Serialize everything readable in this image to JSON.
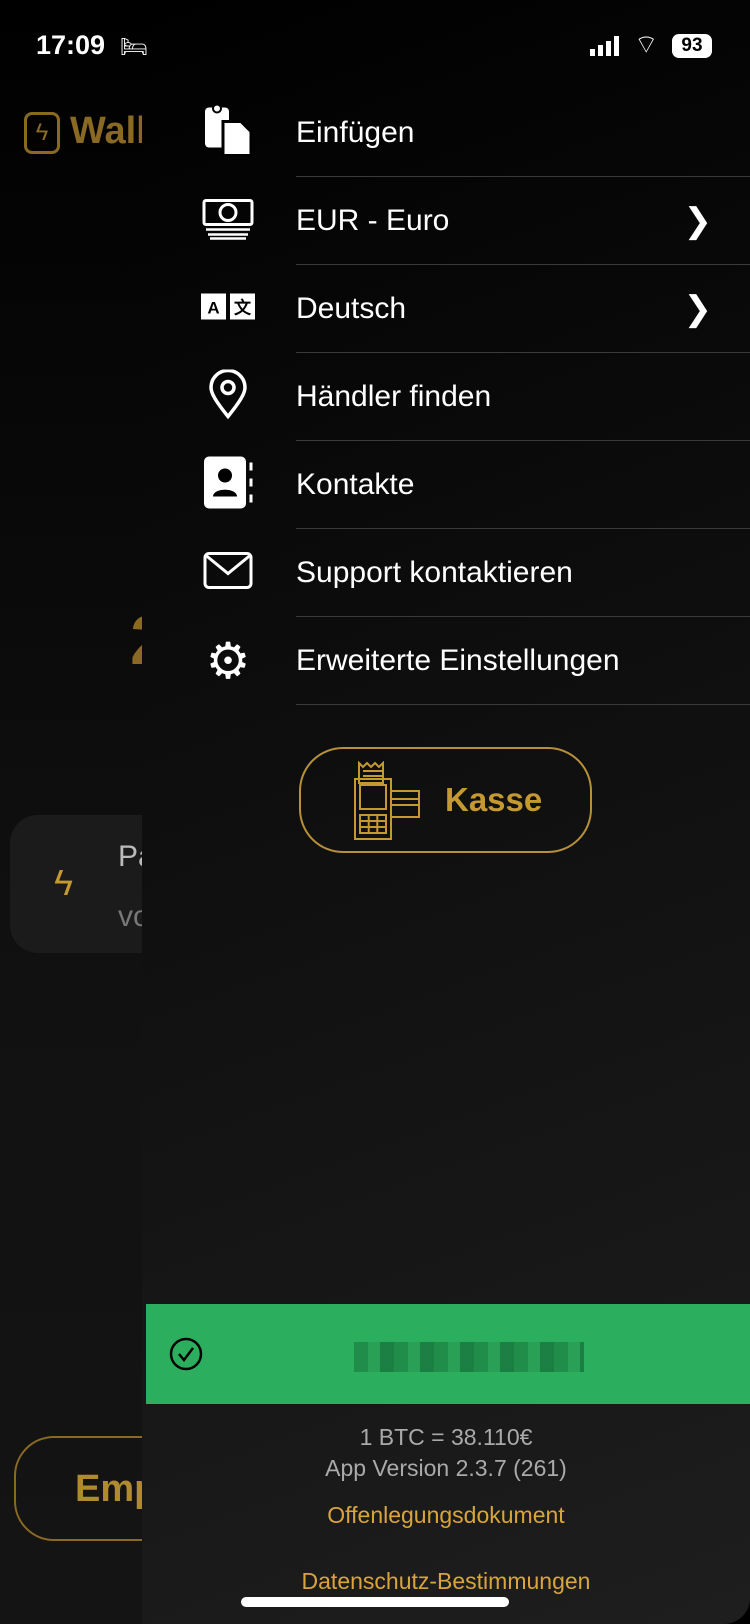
{
  "status_bar": {
    "time": "17:09",
    "battery": "93"
  },
  "background": {
    "logo_text": "Wall",
    "big_number_partial": "2",
    "card_title_partial": "Pa",
    "card_sub_partial": "vo",
    "bottom_button_partial": "Emp"
  },
  "menu": {
    "items": [
      {
        "label": "Einfügen",
        "icon": "paste-icon",
        "chevron": false
      },
      {
        "label": "EUR - Euro",
        "icon": "money-icon",
        "chevron": true
      },
      {
        "label": "Deutsch",
        "icon": "translate-icon",
        "chevron": true
      },
      {
        "label": "Händler finden",
        "icon": "location-pin-icon",
        "chevron": false
      },
      {
        "label": "Kontakte",
        "icon": "contacts-icon",
        "chevron": false
      },
      {
        "label": "Support kontaktieren",
        "icon": "mail-icon",
        "chevron": false
      },
      {
        "label": "Erweiterte Einstellungen",
        "icon": "gear-icon",
        "chevron": false
      }
    ]
  },
  "kasse_button": {
    "label": "Kasse"
  },
  "footer": {
    "btc_rate": "1 BTC = 38.110€",
    "app_version": "App Version 2.3.7 (261)",
    "disclosure_link": "Offenlegungsdokument",
    "privacy_link": "Datenschutz-Bestimmungen"
  },
  "colors": {
    "accent": "#c49a30",
    "success": "#2baf5e"
  }
}
